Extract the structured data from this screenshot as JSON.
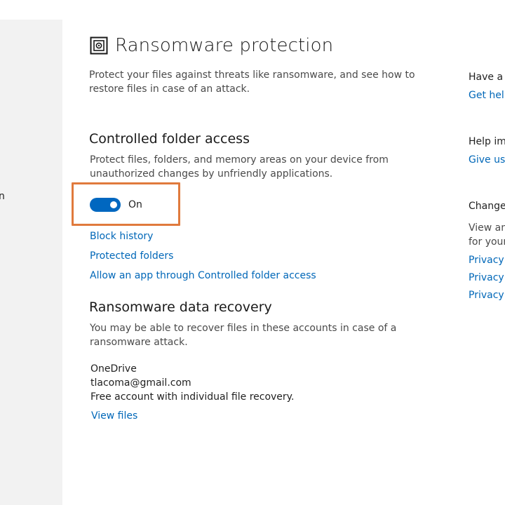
{
  "sidebar": {
    "fragment": "n"
  },
  "header": {
    "title": "Ransomware protection",
    "icon": "shield-icon"
  },
  "intro": "Protect your files against threats like ransomware, and see how to restore files in case of an attack.",
  "controlled_folder_access": {
    "title": "Controlled folder access",
    "description": "Protect files, folders, and memory areas on your device from unauthorized changes by unfriendly applications.",
    "toggle_state": "On",
    "links": {
      "block_history": "Block history",
      "protected_folders": "Protected folders",
      "allow_app": "Allow an app through Controlled folder access"
    }
  },
  "recovery": {
    "title": "Ransomware data recovery",
    "description": "You may be able to recover files in these accounts in case of a ransomware attack.",
    "account_name": "OneDrive",
    "account_email": "tlacoma@gmail.com",
    "account_type": "Free account with individual file recovery.",
    "view_files": "View files"
  },
  "right_column": {
    "q_heading": "Have a q",
    "get_help": "Get help",
    "help_improve": "Help imp",
    "give_feedback": "Give us f",
    "change_heading": "Change",
    "view_line1": "View an",
    "view_line2": "for your",
    "privacy_1": "Privacy s",
    "privacy_2": "Privacy d",
    "privacy_3": "Privacy S"
  },
  "colors": {
    "accent": "#0067b8",
    "toggle": "#0067c0",
    "highlight": "#e07a3d",
    "sidebar": "#f2f2f2"
  }
}
